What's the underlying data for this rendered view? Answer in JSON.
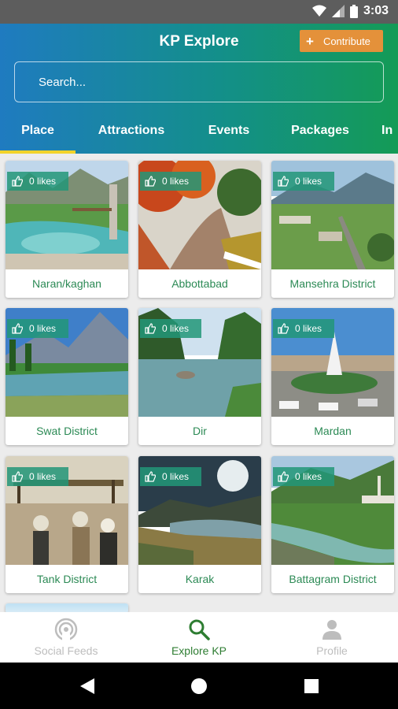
{
  "status_bar": {
    "time": "3:03"
  },
  "header": {
    "title": "KP Explore",
    "contribute_label": "Contribute",
    "search_placeholder": "Search..."
  },
  "tabs": [
    {
      "label": "Place",
      "active": true
    },
    {
      "label": "Attractions",
      "active": false
    },
    {
      "label": "Events",
      "active": false
    },
    {
      "label": "Packages",
      "active": false
    },
    {
      "label": "In",
      "active": false
    }
  ],
  "places": [
    {
      "name": "Naran/kaghan",
      "likes": "0 likes"
    },
    {
      "name": "Abbottabad",
      "likes": "0 likes"
    },
    {
      "name": "Mansehra District",
      "likes": "0 likes"
    },
    {
      "name": "Swat District",
      "likes": "0 likes"
    },
    {
      "name": "Dir",
      "likes": "0 likes"
    },
    {
      "name": "Mardan",
      "likes": "0 likes"
    },
    {
      "name": "Tank District",
      "likes": "0 likes"
    },
    {
      "name": "Karak",
      "likes": "0 likes"
    },
    {
      "name": "Battagram District",
      "likes": "0 likes"
    }
  ],
  "bottom_nav": [
    {
      "label": "Social Feeds",
      "active": false
    },
    {
      "label": "Explore KP",
      "active": true
    },
    {
      "label": "Profile",
      "active": false
    }
  ],
  "colors": {
    "accent": "#e4913a",
    "active_nav": "#2e7d32",
    "inactive_nav": "#bdbdbd",
    "place_label": "#2c8a55",
    "tab_indicator": "#f2d32a"
  }
}
